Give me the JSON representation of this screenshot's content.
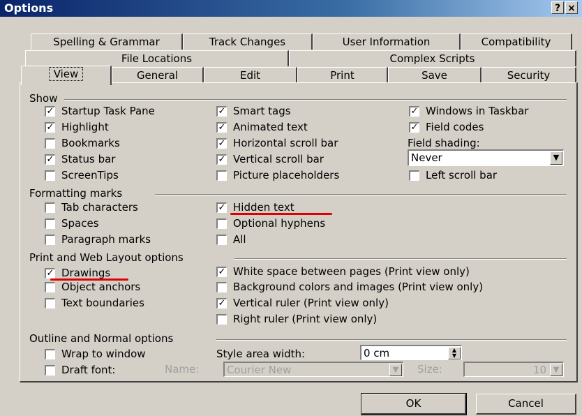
{
  "window": {
    "title": "Options",
    "help": "?",
    "close": "×"
  },
  "tabs_row1": [
    "Spelling & Grammar",
    "Track Changes",
    "User Information",
    "Compatibility"
  ],
  "tabs_row2": [
    "File Locations",
    "Complex Scripts"
  ],
  "tabs_row3": [
    "View",
    "General",
    "Edit",
    "Print",
    "Save",
    "Security"
  ],
  "groups": {
    "show": "Show",
    "formatting": "Formatting marks",
    "print_web": "Print and Web Layout options",
    "outline": "Outline and Normal options"
  },
  "show": {
    "startup_task_pane": "Startup Task Pane",
    "highlight": "Highlight",
    "bookmarks": "Bookmarks",
    "status_bar": "Status bar",
    "screentips": "ScreenTips",
    "smart_tags": "Smart tags",
    "animated_text": "Animated text",
    "horizontal_scroll": "Horizontal scroll bar",
    "vertical_scroll": "Vertical scroll bar",
    "picture_placeholders": "Picture placeholders",
    "windows_in_taskbar": "Windows in Taskbar",
    "field_codes": "Field codes",
    "field_shading_label": "Field shading:",
    "field_shading_value": "Never",
    "left_scroll_bar": "Left scroll bar"
  },
  "formatting": {
    "tab_characters": "Tab characters",
    "spaces": "Spaces",
    "paragraph_marks": "Paragraph marks",
    "hidden_text": "Hidden text",
    "optional_hyphens": "Optional hyphens",
    "all": "All"
  },
  "print_web": {
    "drawings": "Drawings",
    "object_anchors": "Object anchors",
    "text_boundaries": "Text boundaries",
    "white_space": "White space between pages (Print view only)",
    "background_colors": "Background colors and images (Print view only)",
    "vertical_ruler": "Vertical ruler (Print view only)",
    "right_ruler": "Right ruler (Print view only)"
  },
  "outline": {
    "wrap_to_window": "Wrap to window",
    "draft_font": "Draft font:",
    "style_area_label": "Style area width:",
    "style_area_value": "0 cm",
    "name_label": "Name:",
    "name_value": "Courier New",
    "size_label": "Size:",
    "size_value": "10"
  },
  "buttons": {
    "ok": "OK",
    "cancel": "Cancel"
  },
  "check": "✓"
}
